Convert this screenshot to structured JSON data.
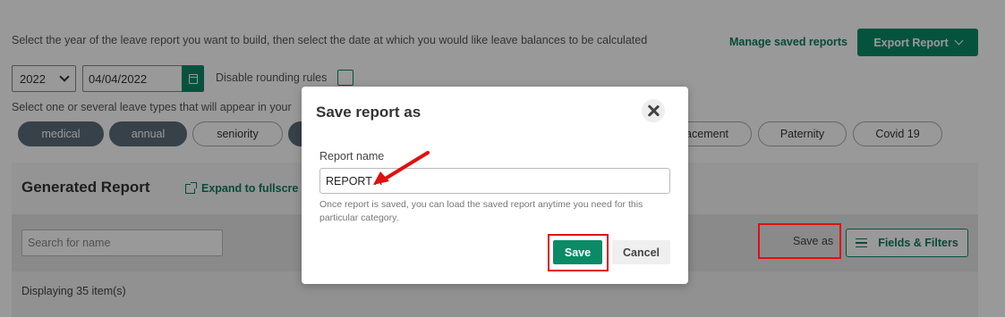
{
  "header": {
    "instruction": "Select the year of the leave report you want to build, then select the date at which you would like leave balances to be calculated",
    "manage_link": "Manage saved reports",
    "export_label": "Export Report"
  },
  "filters": {
    "year": "2022",
    "date": "04/04/2022",
    "rounding_label": "Disable rounding rules",
    "rounding_checked": false,
    "leave_types_instruction": "Select one or several leave types that will appear in your"
  },
  "leave_types": [
    {
      "label": "medical",
      "active": true
    },
    {
      "label": "annual",
      "active": true
    },
    {
      "label": "seniority",
      "active": false
    },
    {
      "label": "",
      "active": true
    },
    {
      "label": "acement",
      "active": false
    },
    {
      "label": "Paternity",
      "active": false
    },
    {
      "label": "Covid 19",
      "active": false
    }
  ],
  "report": {
    "title": "Generated Report",
    "expand_label": "Expand to fullscre",
    "search_placeholder": "Search for name",
    "save_as_label": "Save as",
    "fields_filters_label": "Fields & Filters",
    "displaying": "Displaying 35 item(s)"
  },
  "modal": {
    "title": "Save report as",
    "field_label": "Report name",
    "field_value": "REPORT A",
    "helper_text": "Once report is saved, you can load the saved report anytime you need for this particular category.",
    "save_label": "Save",
    "cancel_label": "Cancel"
  },
  "colors": {
    "accent": "#0b8a66",
    "highlight": "#e01010",
    "pill_active": "#5d6d7b"
  }
}
